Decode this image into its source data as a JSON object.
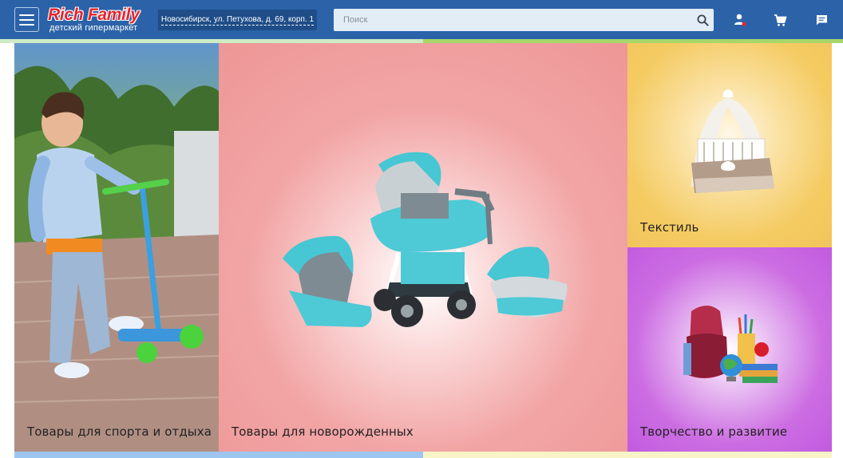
{
  "header": {
    "brand_name": "Rich Family",
    "brand_tagline": "детский гипермаркет",
    "address": "Новосибирск, ул. Петухова, д. 69, корп. 1",
    "search_placeholder": "Поиск"
  },
  "icons": {
    "menu": "menu-icon",
    "search": "search-icon",
    "user": "user-icon",
    "cart": "cart-icon",
    "chat": "chat-icon"
  },
  "colors": {
    "header_bg": "#2b62a8",
    "brand_red": "#e8232b",
    "newborn_tile": "#ee9696",
    "textile_tile": "#f2c55c",
    "creative_tile": "#c25be0"
  },
  "tiles": [
    {
      "label": "Товары для спорта и отдыха"
    },
    {
      "label": "Товары для новорожденных"
    },
    {
      "label": "Текстиль"
    },
    {
      "label": "Творчество и развитие"
    }
  ]
}
